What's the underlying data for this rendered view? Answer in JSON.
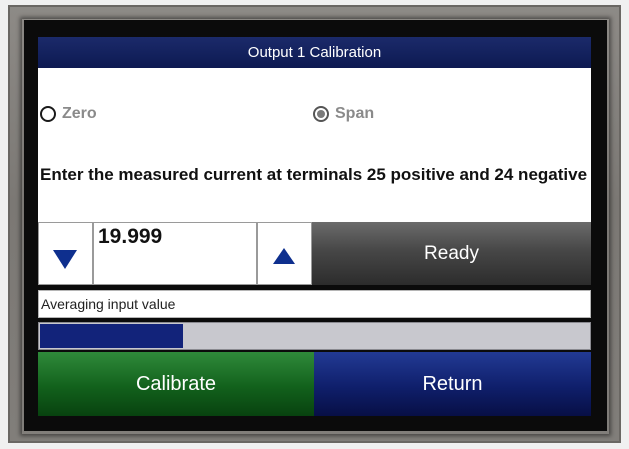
{
  "window": {
    "title": "Output 1 Calibration"
  },
  "mode": {
    "zero_label": "Zero",
    "span_label": "Span",
    "selected": "Span"
  },
  "instruction": "Enter the measured current at terminals 25 positive and 24 negative",
  "entry": {
    "value": "19.999"
  },
  "ready_label": "Ready",
  "status_text": "Averaging input value",
  "progress": {
    "fraction": 0.26,
    "color": "#12237a"
  },
  "buttons": {
    "calibrate_label": "Calibrate",
    "return_label": "Return"
  },
  "colors": {
    "title_bar": "#0d1a52",
    "calibrate": "#12611c",
    "return": "#0f1f6b",
    "arrow": "#0e2f8e"
  },
  "icons": {
    "decrement": "triangle-down-icon",
    "increment": "triangle-up-icon"
  }
}
